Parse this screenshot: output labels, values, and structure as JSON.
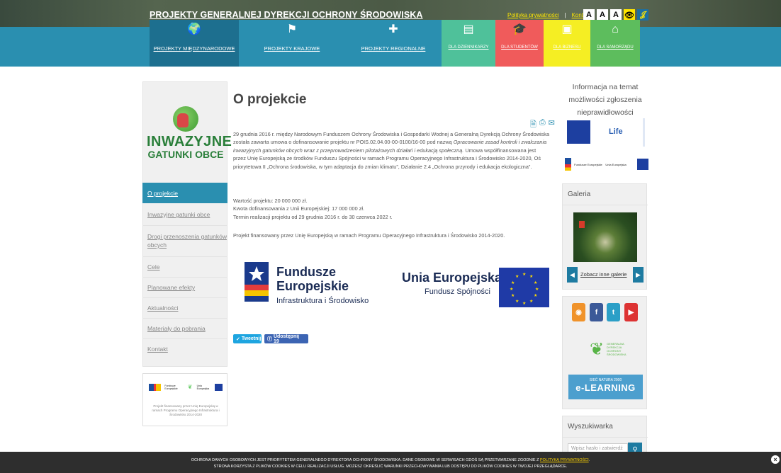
{
  "header": {
    "site_title": "PROJEKTY GENERALNEJ DYREKCJI OCHRONY ŚRODOWISKA",
    "top_links": [
      "Polityka prywatności",
      "Kontakt"
    ],
    "access_buttons": [
      "A",
      "A",
      "A",
      "👁",
      "𝒥"
    ],
    "nav": [
      {
        "label": "PROJEKTY MIĘDZYNARODOWE",
        "icon": "globe-icon",
        "glyph": "🌍"
      },
      {
        "label": "PROJEKTY KRAJOWE",
        "icon": "flag-icon",
        "glyph": "⚑"
      },
      {
        "label": "PROJEKTY REGIONALNE",
        "icon": "signpost-icon",
        "glyph": "✚"
      },
      {
        "label": "DLA DZIENNIKARZY",
        "icon": "document-icon",
        "glyph": "▤"
      },
      {
        "label": "DLA STUDENTÓW",
        "icon": "graduation-icon",
        "glyph": "🎓"
      },
      {
        "label": "DLA BIZNESU",
        "icon": "money-icon",
        "glyph": "▣"
      },
      {
        "label": "DLA SAMORZĄDU",
        "icon": "home-icon",
        "glyph": "⌂"
      }
    ]
  },
  "sidebar": {
    "logo_title": "INWAZYJNE",
    "logo_sub": "GATUNKI OBCE",
    "menu": [
      "O projekcie",
      "Inwazyjne gatunki obce",
      "Drogi przenoszenia gatunków obcych",
      "Cele",
      "Planowane efekty",
      "Aktualności",
      "Materiały do pobrania",
      "Kontakt"
    ],
    "banner_note": "Projekt finansowany przez Unię Europejską w ramach Programu Operacyjnego Infrastruktura i Środowisko 2014-2020",
    "banner_fe": "Fundusze Europejskie",
    "banner_ue": "Unia Europejska"
  },
  "main": {
    "title": "O projekcie",
    "paragraph1_a": "29 grudnia 2016 r. między Narodowym Funduszem Ochrony Środowiska i Gospodarki Wodnej a Generalną Dyrekcją Ochrony Środowiska została zawarta umowa o dofinansowanie projektu nr POIS.02.04.00-00-0100/16-00 pod nazwą ",
    "paragraph1_em": "Opracowanie zasad kontroli i zwalczania inwazyjnych gatunków obcych wraz z przeprowadzeniem pilotażowych działań i edukacją społeczną.",
    "paragraph1_b": " Umowa współfinansowana jest przez Unię Europejską ze środków Funduszu Spójności w ramach Programu Operacyjnego Infrastruktura i Środowisko 2014-2020, Oś priorytetowa II „Ochrona środowiska, w tym adaptacja do zmian klimatu”, Działanie 2.4 „Ochrona przyrody i edukacja ekologiczna”.",
    "value": "Wartość projektu: 20 000 000 zł.",
    "funding": "Kwota dofinansowania z Unii Europejskiej: 17 000 000 zł.",
    "dates": "Termin realizacji projektu od 29 grudnia 2016 r. do 30 czerwca 2022 r.",
    "paragraph3": "Projekt finansowany przez Unię Europejską w ramach Programu Operacyjnego Infrastruktura i Środowisko 2014-2020.",
    "fe_line1": "Fundusze",
    "fe_line2": "Europejskie",
    "fe_sub": "Infrastruktura i Środowisko",
    "ue_name": "Unia Europejska",
    "ue_sub": "Fundusz Spójności",
    "share_tw": "Tweetnij",
    "share_fb": "Udostępnij 19"
  },
  "right": {
    "info_title": "Informacja na temat możliwości zgłoszenia nieprawidłowości",
    "life_text": "Life",
    "fund_text": "Fundusze Europejskie",
    "fund_ue": "Unia Europejska",
    "gallery_title": "Galeria",
    "gallery_link": "Zobacz inne galerie",
    "social": [
      "rss",
      "f",
      "t",
      "You Tube"
    ],
    "green_logo_text": "GENERALNA DYREKCJA OCHRONY ŚRODOWISKA",
    "elearn_small": "SIEĆ NATURA 2000",
    "elearn_big": "e-LEARNING",
    "search_title": "Wyszukiwarka",
    "search_placeholder": "Wpisz hasło i zatwierdź"
  },
  "cookie": {
    "line1_a": "OCHRONA DANYCH OSOBOWYCH JEST PRIORYTETEM GENERALNEGO DYREKTORA OCHRONY ŚRODOWISKA. DANE OSOBOWE W SERWISACH GDOŚ SĄ PRZETWARZANE ZGODNIE Z ",
    "line1_link": "POLITYKĄ PRYWATNOŚCI",
    "line1_b": ".",
    "line2": "STRONA KORZYSTA Z PLIKÓW COOKIES W CELU REALIZACJI USŁUG. MOŻESZ OKREŚLIĆ WARUNKI PRZECHOWYWANIA LUB DOSTĘPU DO PLIKÓW COOKIES W TWOJEJ PRZEGLĄDARCE."
  }
}
